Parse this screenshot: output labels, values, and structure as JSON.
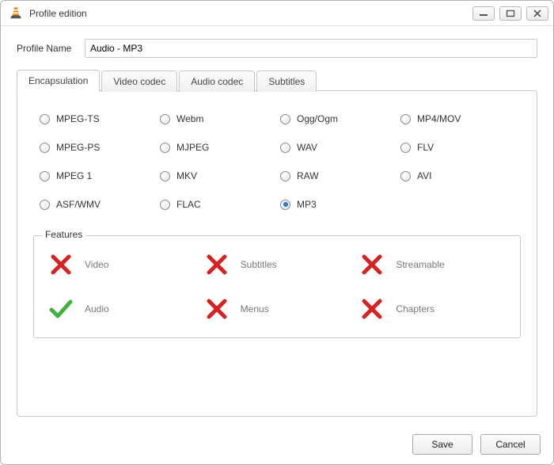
{
  "window": {
    "title": "Profile edition"
  },
  "profile": {
    "label": "Profile Name",
    "value": "Audio - MP3"
  },
  "tabs": [
    {
      "label": "Encapsulation",
      "active": true
    },
    {
      "label": "Video codec",
      "active": false
    },
    {
      "label": "Audio codec",
      "active": false
    },
    {
      "label": "Subtitles",
      "active": false
    }
  ],
  "formats": [
    {
      "id": "mpeg-ts",
      "label": "MPEG-TS",
      "checked": false
    },
    {
      "id": "webm",
      "label": "Webm",
      "checked": false
    },
    {
      "id": "ogg",
      "label": "Ogg/Ogm",
      "checked": false
    },
    {
      "id": "mp4",
      "label": "MP4/MOV",
      "checked": false
    },
    {
      "id": "mpeg-ps",
      "label": "MPEG-PS",
      "checked": false
    },
    {
      "id": "mjpeg",
      "label": "MJPEG",
      "checked": false
    },
    {
      "id": "wav",
      "label": "WAV",
      "checked": false
    },
    {
      "id": "flv",
      "label": "FLV",
      "checked": false
    },
    {
      "id": "mpeg1",
      "label": "MPEG 1",
      "checked": false
    },
    {
      "id": "mkv",
      "label": "MKV",
      "checked": false
    },
    {
      "id": "raw",
      "label": "RAW",
      "checked": false
    },
    {
      "id": "avi",
      "label": "AVI",
      "checked": false
    },
    {
      "id": "asf",
      "label": "ASF/WMV",
      "checked": false
    },
    {
      "id": "flac",
      "label": "FLAC",
      "checked": false
    },
    {
      "id": "mp3",
      "label": "MP3",
      "checked": true
    }
  ],
  "features": {
    "legend": "Features",
    "items": [
      {
        "id": "video",
        "label": "Video",
        "supported": false
      },
      {
        "id": "subtitles",
        "label": "Subtitles",
        "supported": false
      },
      {
        "id": "streamable",
        "label": "Streamable",
        "supported": false
      },
      {
        "id": "audio",
        "label": "Audio",
        "supported": true
      },
      {
        "id": "menus",
        "label": "Menus",
        "supported": false
      },
      {
        "id": "chapters",
        "label": "Chapters",
        "supported": false
      }
    ]
  },
  "footer": {
    "save": "Save",
    "cancel": "Cancel"
  }
}
